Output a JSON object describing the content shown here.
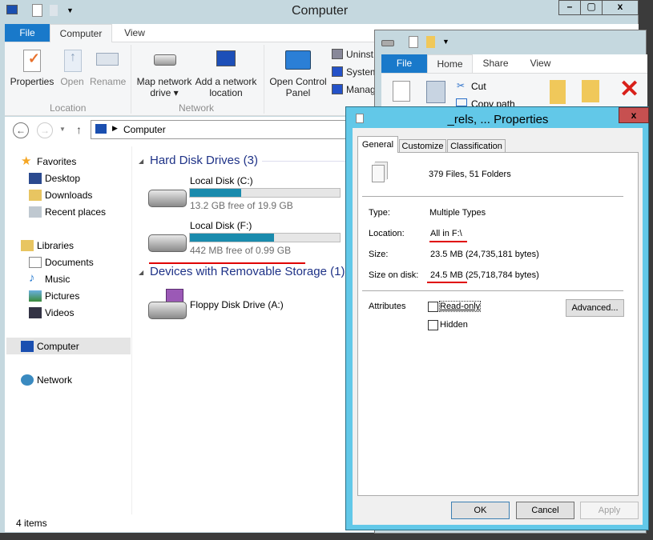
{
  "main_window": {
    "title": "Computer",
    "tabs": {
      "file": "File",
      "computer": "Computer",
      "view": "View"
    },
    "ribbon": {
      "properties": "Properties",
      "open": "Open",
      "rename": "Rename",
      "location_group": "Location",
      "map_network_drive": "Map network",
      "map_network_drive2": "drive ▾",
      "add_network_location": "Add a network",
      "add_network_location2": "location",
      "network_group": "Network",
      "open_control_panel": "Open Control",
      "open_control_panel2": "Panel",
      "uninstall": "Uninst",
      "system": "System",
      "manage": "Manag"
    },
    "address": {
      "path": "Computer"
    },
    "nav": {
      "favorites": "Favorites",
      "desktop": "Desktop",
      "downloads": "Downloads",
      "recent": "Recent places",
      "libraries": "Libraries",
      "documents": "Documents",
      "music": "Music",
      "pictures": "Pictures",
      "videos": "Videos",
      "computer": "Computer",
      "network": "Network"
    },
    "content": {
      "hdd_header": "Hard Disk Drives (3)",
      "drives": [
        {
          "name": "Local Disk (C:)",
          "free": "13.2 GB free of 19.9 GB",
          "used_fraction": 0.34
        },
        {
          "name": "Local Disk (F:)",
          "free": "442 MB free of 0.99 GB",
          "used_fraction": 0.56
        }
      ],
      "removable_header": "Devices with Removable Storage (1)",
      "floppy": "Floppy Disk Drive (A:)"
    },
    "status": "4 items"
  },
  "second_window": {
    "tabs": {
      "file": "File",
      "home": "Home",
      "share": "Share",
      "view": "View"
    },
    "cut": "Cut",
    "copy_path": "Copy path"
  },
  "dialog": {
    "title": "_rels, ... Properties",
    "close": "x",
    "tabs": [
      "General",
      "Customize",
      "Classification"
    ],
    "summary": "379 Files, 51 Folders",
    "type_label": "Type:",
    "type_value": "Multiple Types",
    "location_label": "Location:",
    "location_value": "All in F:\\",
    "size_label": "Size:",
    "size_value": "23.5 MB (24,735,181 bytes)",
    "size_disk_label": "Size on disk:",
    "size_disk_value": "24.5 MB (25,718,784 bytes)",
    "attributes_label": "Attributes",
    "readonly": "Read-only",
    "hidden": "Hidden",
    "advanced": "Advanced...",
    "ok": "OK",
    "cancel": "Cancel",
    "apply": "Apply"
  },
  "colors": {
    "accent": "#1979ca",
    "annotation": "#e00000",
    "dialog_frame": "#62c8e8",
    "bar": "#1a8bad"
  }
}
